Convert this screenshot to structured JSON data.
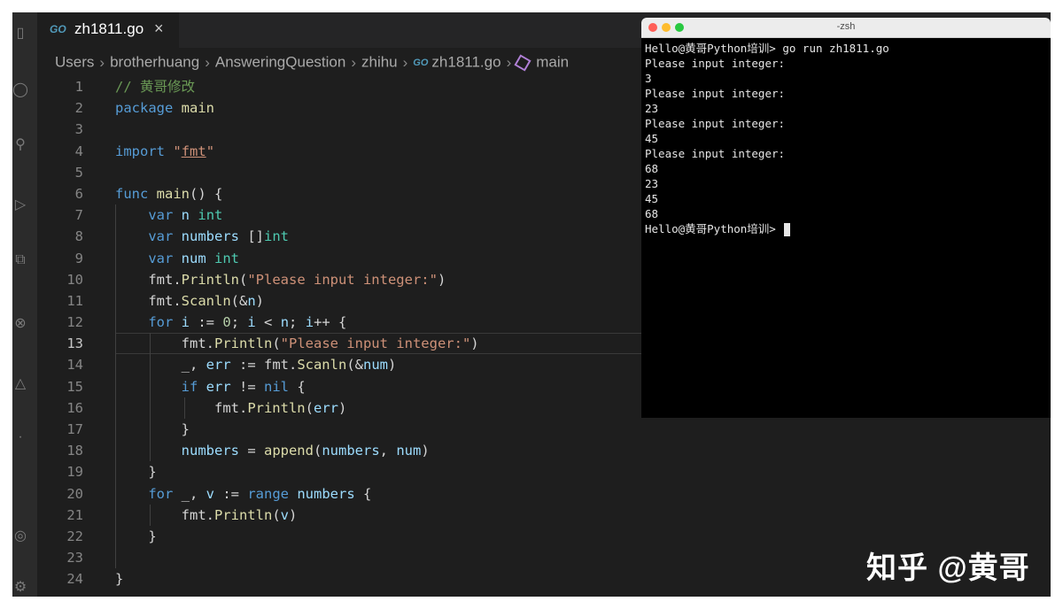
{
  "editor": {
    "tab": {
      "icon": "go-file-icon",
      "title": "zh1811.go",
      "close": "×"
    },
    "breadcrumb": [
      "Users",
      "brotherhuang",
      "AnsweringQuestion",
      "zhihu",
      "zh1811.go",
      "main"
    ],
    "breadcrumb_go_label": "GO",
    "active_line": 13
  },
  "code_lines": [
    "// 黄哥修改",
    "package main",
    "",
    "import \"fmt\"",
    "",
    "func main() {",
    "    var n int",
    "    var numbers []int",
    "    var num int",
    "    fmt.Println(\"Please input integer:\")",
    "    fmt.Scanln(&n)",
    "    for i := 0; i < n; i++ {",
    "        fmt.Println(\"Please input integer:\")",
    "        _, err := fmt.Scanln(&num)",
    "        if err != nil {",
    "            fmt.Println(err)",
    "        }",
    "        numbers = append(numbers, num)",
    "    }",
    "    for _, v := range numbers {",
    "        fmt.Println(v)",
    "    }",
    "",
    "}"
  ],
  "line_numbers": [
    "1",
    "2",
    "3",
    "4",
    "5",
    "6",
    "7",
    "8",
    "9",
    "10",
    "11",
    "12",
    "13",
    "14",
    "15",
    "16",
    "17",
    "18",
    "19",
    "20",
    "21",
    "22",
    "23",
    "24"
  ],
  "terminal": {
    "title": "-zsh",
    "lines": [
      "Hello@黄哥Python培训> go run zh1811.go",
      "Please input integer:",
      "3",
      "Please input integer:",
      "23",
      "Please input integer:",
      "45",
      "Please input integer:",
      "68",
      "23",
      "45",
      "68",
      "Hello@黄哥Python培训> "
    ]
  },
  "watermark": "知乎 @黄哥",
  "colors": {
    "keyword": "#569cd6",
    "function": "#dcdcaa",
    "type": "#4ec9b0",
    "string": "#ce9178",
    "number": "#b5cea8",
    "variable": "#9cdcfe",
    "comment": "#6a9955"
  }
}
